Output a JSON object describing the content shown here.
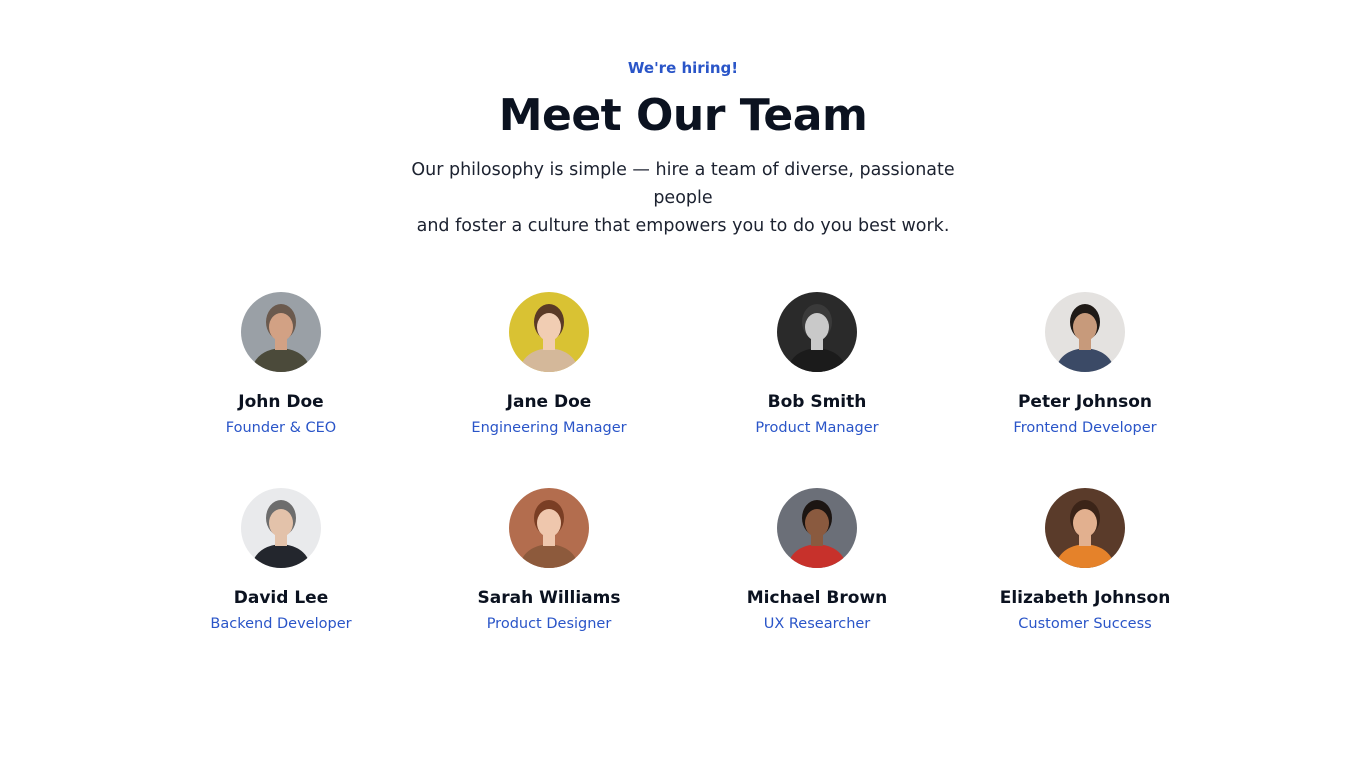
{
  "header": {
    "eyebrow": "We're hiring!",
    "title": "Meet Our Team",
    "subtitle_line1": "Our philosophy is simple — hire a team of diverse, passionate people",
    "subtitle_line2": "and foster a culture that empowers you to do you best work."
  },
  "colors": {
    "accent": "#2a55c8",
    "heading": "#0b1220"
  },
  "team": [
    {
      "name": "John Doe",
      "role": "Founder & CEO",
      "bg": "#9aa0a6",
      "skin": "#d2a184",
      "hair": "#6b5a4e",
      "shirt": "#4b4a3a"
    },
    {
      "name": "Jane Doe",
      "role": "Engineering Manager",
      "bg": "#d9c233",
      "skin": "#f1cdb3",
      "hair": "#5a3a26",
      "shirt": "#d4b89a"
    },
    {
      "name": "Bob Smith",
      "role": "Product Manager",
      "bg": "#2a2a2a",
      "skin": "#c9c9c9",
      "hair": "#3a3a3a",
      "shirt": "#1b1b1b"
    },
    {
      "name": "Peter Johnson",
      "role": "Frontend Developer",
      "bg": "#e4e2e0",
      "skin": "#c79a7b",
      "hair": "#1f1a17",
      "shirt": "#3b4a66"
    },
    {
      "name": "David Lee",
      "role": "Backend Developer",
      "bg": "#e9eaec",
      "skin": "#e3c2aa",
      "hair": "#6d6d6d",
      "shirt": "#23262d"
    },
    {
      "name": "Sarah Williams",
      "role": "Product Designer",
      "bg": "#b36d4e",
      "skin": "#efc7ad",
      "hair": "#7a3e24",
      "shirt": "#8d5a3c"
    },
    {
      "name": "Michael Brown",
      "role": "UX Researcher",
      "bg": "#6b6f78",
      "skin": "#8a5a3f",
      "hair": "#1c1512",
      "shirt": "#c7312b"
    },
    {
      "name": "Elizabeth Johnson",
      "role": "Customer Success",
      "bg": "#5a3b2a",
      "skin": "#e2b08f",
      "hair": "#3b2418",
      "shirt": "#e5822a"
    }
  ]
}
